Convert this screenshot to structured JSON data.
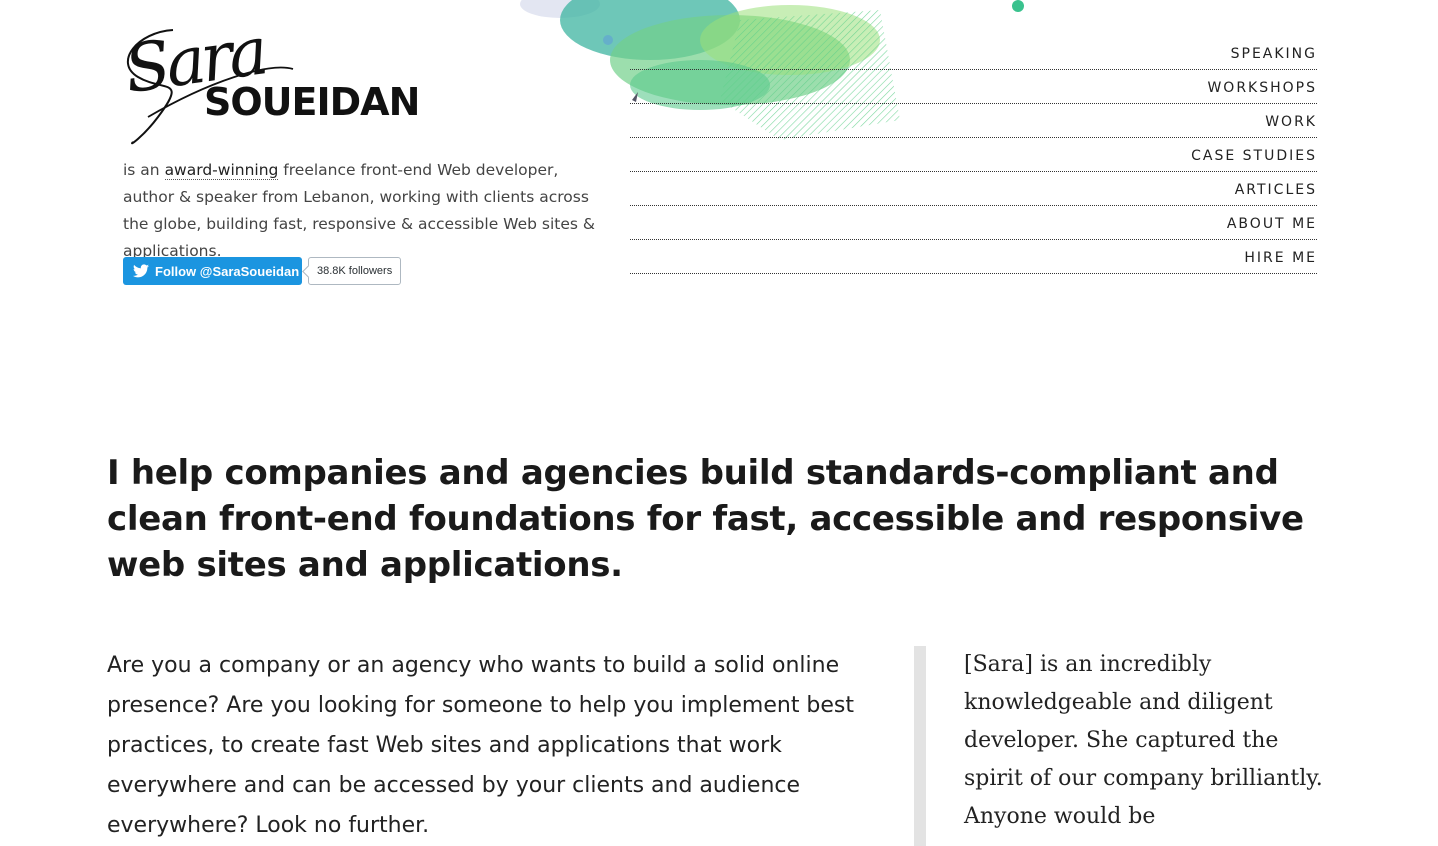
{
  "logo": {
    "script_text": "Sara",
    "block_text": "SOUEIDAN"
  },
  "intro": {
    "prefix": "is an ",
    "highlight": "award-winning",
    "suffix": " freelance front-end Web developer, author & speaker from Lebanon, working with clients across the globe, building fast, responsive & accessible Web sites & applications."
  },
  "twitter": {
    "follow_label": "Follow @SaraSoueidan",
    "followers_label": "38.8K followers",
    "icon": "twitter-bird-icon",
    "brand_color": "#1b95e0"
  },
  "nav": {
    "items": [
      {
        "label": "SPEAKING"
      },
      {
        "label": "WORKSHOPS"
      },
      {
        "label": "WORK"
      },
      {
        "label": "CASE STUDIES"
      },
      {
        "label": "ARTICLES"
      },
      {
        "label": "ABOUT ME"
      },
      {
        "label": "HIRE ME"
      }
    ]
  },
  "main": {
    "headline": "I help companies and agencies build standards-compliant and clean front-end foundations for fast, accessible and responsive web sites and applications.",
    "body": "Are you a company or an agency who wants to build a solid online presence? Are you looking for someone to help you implement best practices, to create fast Web sites and applications that work everywhere and can be accessed by your clients and audience everywhere? Look no further.",
    "quote": "[Sara] is an incredibly knowledgeable and diligent developer. She captured the spirit of our company brilliantly. Anyone would be"
  },
  "colors": {
    "splash_green": "#59c98a",
    "splash_teal": "#3fb8a8",
    "quote_bar": "#e3e3e3"
  }
}
